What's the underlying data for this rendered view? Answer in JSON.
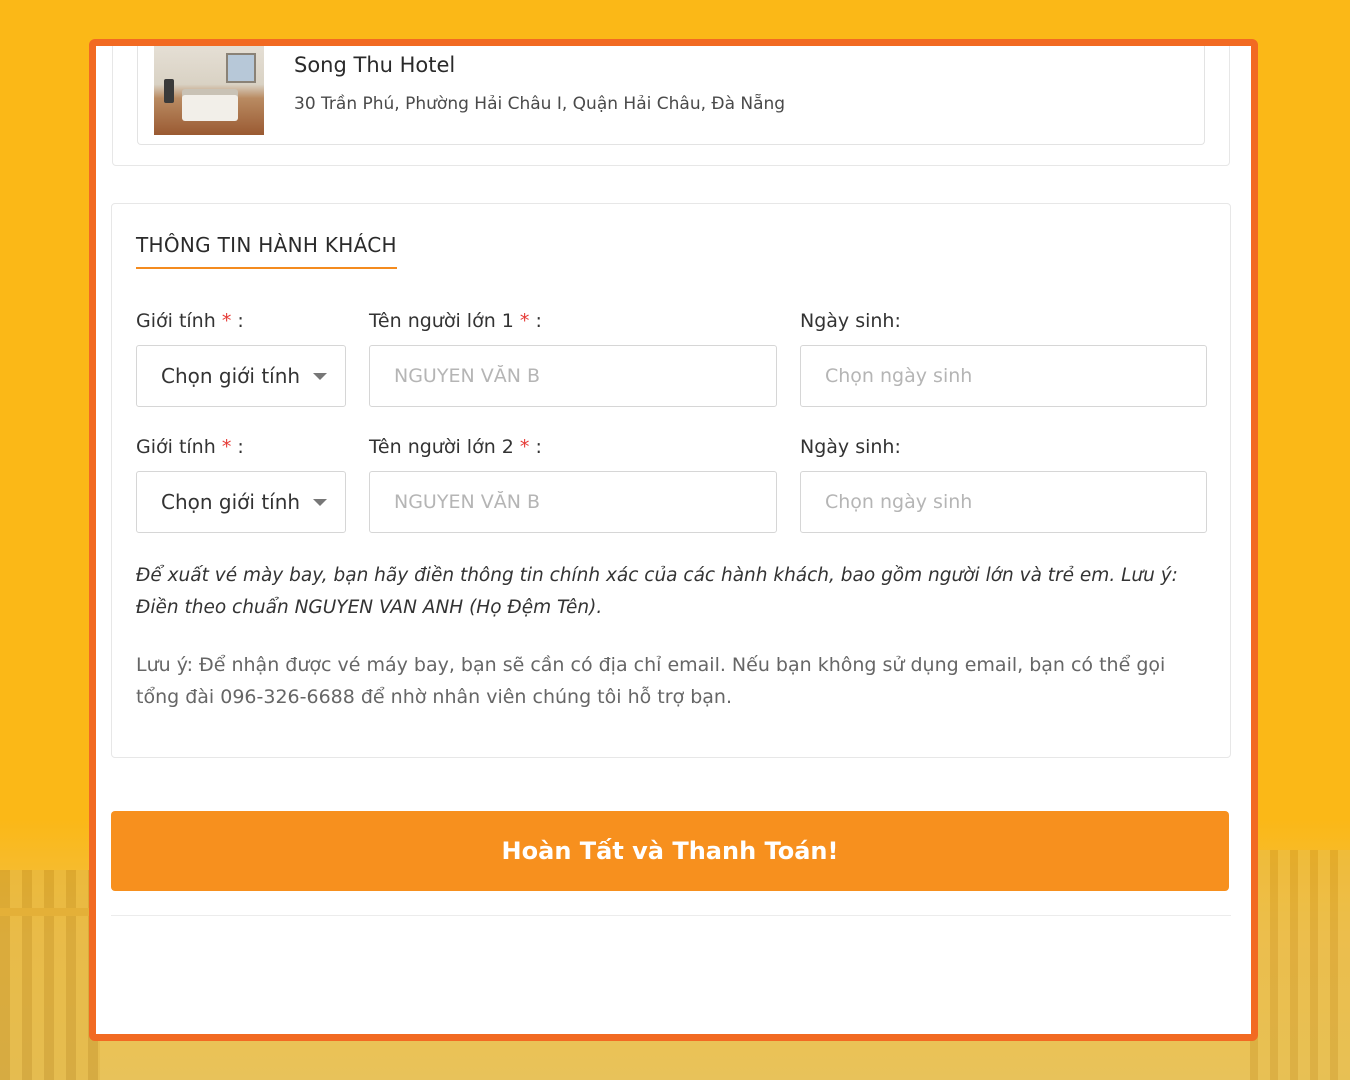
{
  "hotel": {
    "name": "Song Thu Hotel",
    "address": "30 Trần Phú, Phường Hải Châu I, Quận Hải Châu, Đà Nẵng"
  },
  "passenger_info": {
    "title": "THÔNG TIN HÀNH KHÁCH",
    "rows": [
      {
        "gender_label": "Giới tính",
        "gender_select_value": "Chọn giới tính",
        "name_label": "Tên người lớn 1",
        "name_placeholder": "NGUYEN VĂN B",
        "dob_label": "Ngày sinh:",
        "dob_placeholder": "Chọn ngày sinh"
      },
      {
        "gender_label": "Giới tính",
        "gender_select_value": "Chọn giới tính",
        "name_label": "Tên người lớn 2",
        "name_placeholder": "NGUYEN VĂN B",
        "dob_label": "Ngày sinh:",
        "dob_placeholder": "Chọn ngày sinh"
      }
    ],
    "required_mark": "*",
    "label_suffix": ":",
    "note_italic": "Để xuất vé mày bay, bạn hãy điền thông tin chính xác của các hành khách, bao gồm người lớn và trẻ em. Lưu ý: Điền theo chuẩn NGUYEN VAN ANH (Họ Đệm Tên).",
    "note_plain": "Lưu ý: Để nhận được vé máy bay, bạn sẽ cần có địa chỉ email. Nếu bạn không sử dụng email, bạn có thể gọi tổng đài 096-326-6688 để nhờ nhân viên chúng tôi hỗ trợ bạn."
  },
  "submit": {
    "label": "Hoàn Tất và Thanh Toán!"
  },
  "colors": {
    "background": "#fbb817",
    "frame_border": "#f26a22",
    "accent": "#f7901e",
    "required": "#e53935"
  }
}
